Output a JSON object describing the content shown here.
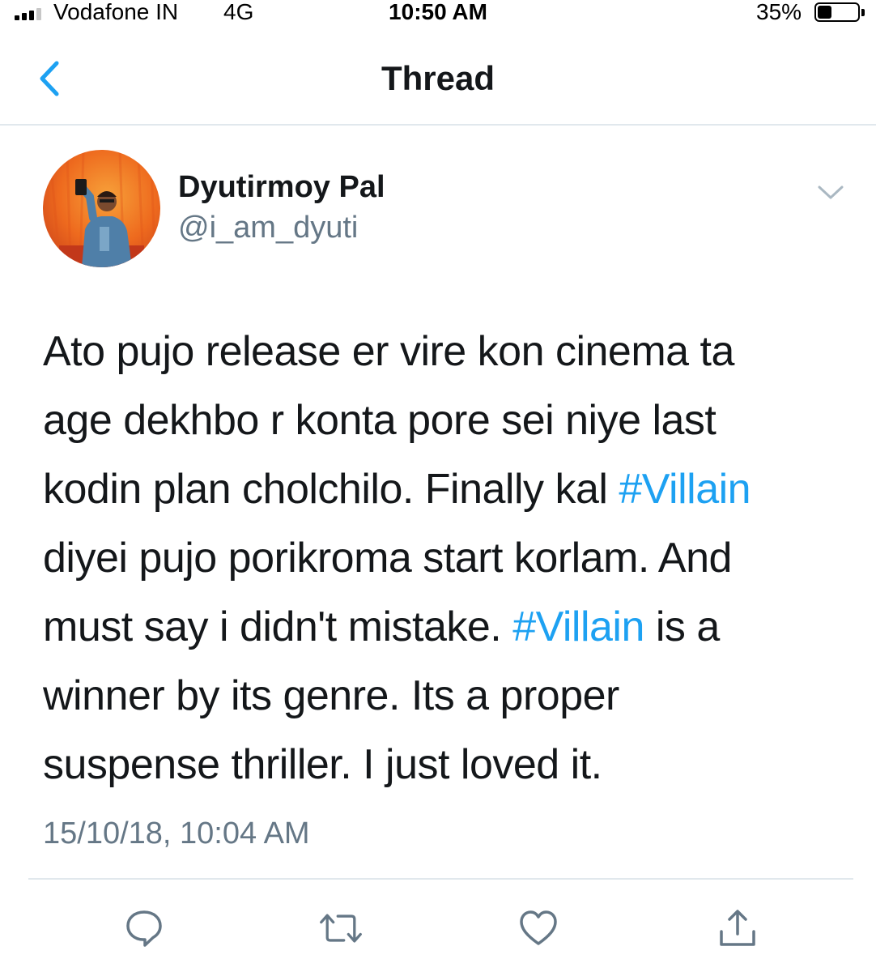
{
  "status_bar": {
    "carrier": "Vodafone IN",
    "network": "4G",
    "time": "10:50 AM",
    "battery_percent": "35%",
    "battery_level": 0.35,
    "signal_bars": 3
  },
  "nav": {
    "title": "Thread",
    "back_icon": "chevron-left-icon"
  },
  "tweet": {
    "author_name": "Dyutirmoy Pal",
    "author_handle": "@i_am_dyuti",
    "more_icon": "chevron-down-icon",
    "lines": [
      [
        {
          "text": "Ato pujo release er vire kon cinema ta"
        }
      ],
      [
        {
          "text": "age dekhbo r konta pore sei niye last"
        }
      ],
      [
        {
          "text": "kodin plan cholchilo. Finally kal "
        },
        {
          "text": "#Villain",
          "hashtag": true
        }
      ],
      [
        {
          "text": "diyei pujo porikroma start korlam. And"
        }
      ],
      [
        {
          "text": "must say i didn't mistake. "
        },
        {
          "text": "#Villain",
          "hashtag": true
        },
        {
          "text": " is a"
        }
      ],
      [
        {
          "text": "winner by its genre. Its a proper"
        }
      ],
      [
        {
          "text": "suspense thriller. I just loved it."
        }
      ]
    ],
    "timestamp": "15/10/18, 10:04 AM"
  },
  "actions": [
    {
      "name": "reply-button",
      "icon": "reply-icon"
    },
    {
      "name": "retweet-button",
      "icon": "retweet-icon"
    },
    {
      "name": "like-button",
      "icon": "heart-icon"
    },
    {
      "name": "share-button",
      "icon": "share-icon"
    }
  ],
  "colors": {
    "accent": "#1da1f2",
    "text": "#14171a",
    "secondary": "#657786",
    "divider": "#e1e8ed",
    "icon": "#657786"
  }
}
